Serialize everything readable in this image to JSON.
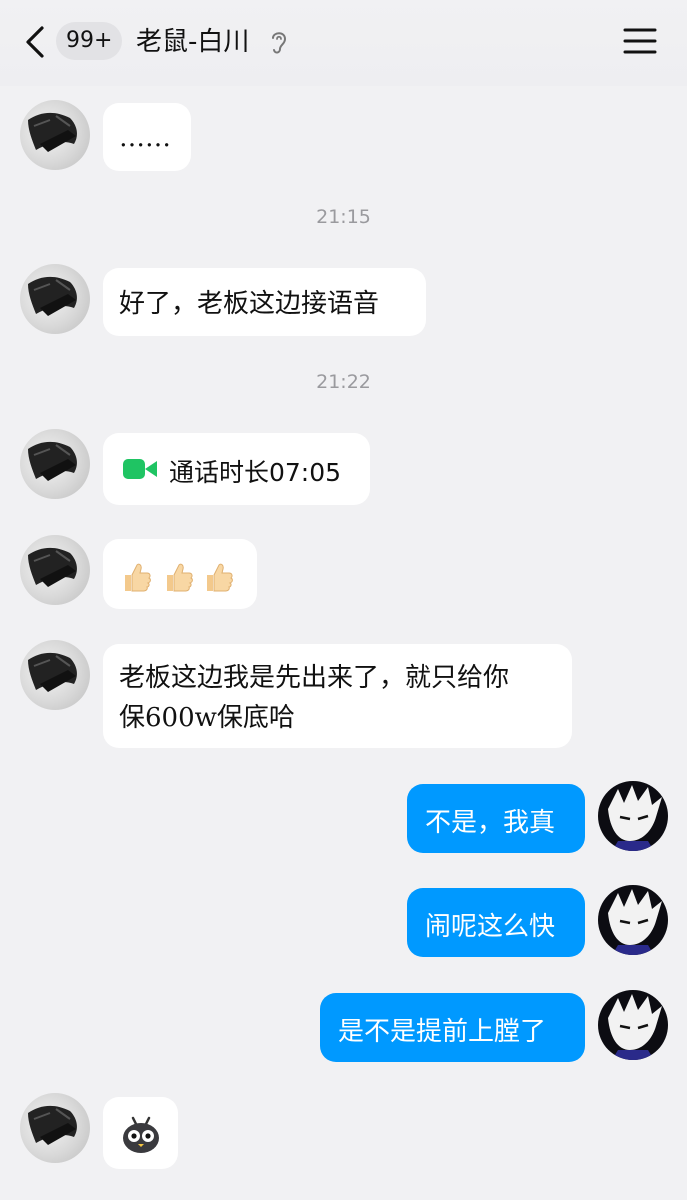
{
  "header": {
    "back_icon": "chevron-left-icon",
    "unread_badge": "99+",
    "title": "老鼠-白川",
    "ear_icon": "ear-icon",
    "menu_icon": "menu-icon"
  },
  "messages": [
    {
      "side": "left",
      "text": "……"
    },
    {
      "type": "time",
      "text": "21:15"
    },
    {
      "side": "left",
      "text": "好了，老板这边接语音"
    },
    {
      "type": "time",
      "text": "21:22"
    },
    {
      "side": "left",
      "type": "call",
      "icon": "video-call-icon",
      "text": "通话时长07:05"
    },
    {
      "side": "left",
      "type": "emoji",
      "icon": "thumbs-up-icon",
      "count": 3
    },
    {
      "side": "left",
      "lines": [
        "老板这边我是先出来了，就只给你",
        "保600w保底哈"
      ]
    },
    {
      "side": "right",
      "text": "不是，我真"
    },
    {
      "side": "right",
      "text": "闹呢这么快"
    },
    {
      "side": "right",
      "text": "是不是提前上膛了"
    },
    {
      "side": "left",
      "type": "sticker",
      "icon": "bird-sticker-icon"
    }
  ],
  "colors": {
    "background": "#f1f1f3",
    "outgoing_bubble": "#0099ff",
    "incoming_bubble": "#ffffff",
    "call_icon": "#1fc463",
    "timestamp": "#9a9a9e"
  }
}
